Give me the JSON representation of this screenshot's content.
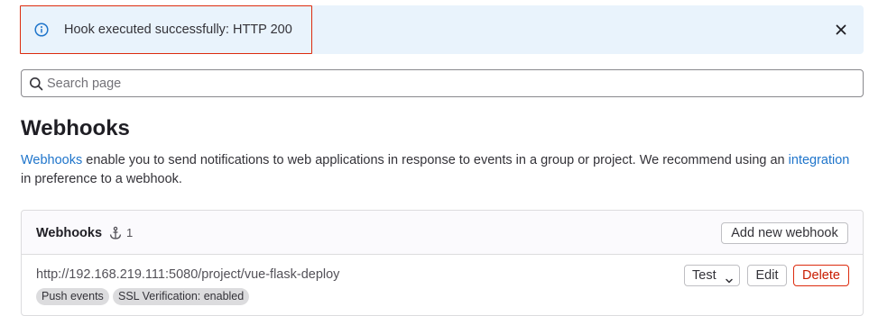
{
  "alert": {
    "message": "Hook executed successfully: HTTP 200",
    "icon": "info-icon",
    "close_icon": "close-icon"
  },
  "search": {
    "placeholder": "Search page",
    "value": "",
    "icon": "search-icon"
  },
  "page": {
    "title": "Webhooks",
    "description_link_1": "Webhooks",
    "description_part_1": " enable you to send notifications to web applications in response to events in a group or project. We recommend using an ",
    "description_link_2": "integration",
    "description_part_2": " in preference to a webhook."
  },
  "webhooks_card": {
    "title": "Webhooks",
    "count_icon": "anchor-icon",
    "count": "1",
    "add_button": "Add new webhook",
    "hooks": [
      {
        "url": "http://192.168.219.111:5080/project/vue-flask-deploy",
        "badges": [
          "Push events",
          "SSL Verification: enabled"
        ],
        "test_label": "Test",
        "edit_label": "Edit",
        "delete_label": "Delete"
      }
    ]
  },
  "colors": {
    "alert_bg": "#e9f3fc",
    "link": "#1f75cb",
    "danger": "#dd2b0e",
    "highlight_border": "#dd2b0e"
  }
}
